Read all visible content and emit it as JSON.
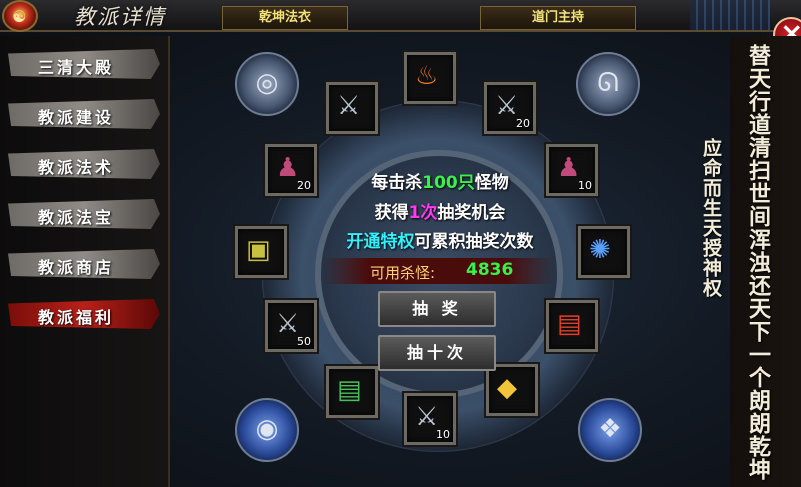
{
  "header": {
    "title": "教派详情",
    "tabs": [
      {
        "label": "乾坤法衣"
      },
      {
        "label": "道门主持"
      }
    ],
    "close_icon": "close-icon"
  },
  "sidebar": {
    "items": [
      {
        "label": "三清大殿",
        "active": false
      },
      {
        "label": "教派建设",
        "active": false
      },
      {
        "label": "教派法术",
        "active": false
      },
      {
        "label": "教派法宝",
        "active": false
      },
      {
        "label": "教派商店",
        "active": false
      },
      {
        "label": "教派福利",
        "active": true
      }
    ]
  },
  "lottery": {
    "line1_a": "每击杀",
    "line1_b": "100只",
    "line1_c": "怪物",
    "line2_a": "获得",
    "line2_b": "1次",
    "line2_c": "抽奖机会",
    "line3_a": "开通特权",
    "line3_b": "可累积抽奖次数",
    "kills_label": "可用杀怪:",
    "kills_value": "4836",
    "draw_once": "抽 奖",
    "draw_ten": "抽十次"
  },
  "prizes": [
    {
      "icon": "fire-scroll-icon",
      "count": ""
    },
    {
      "icon": "dagger-icon",
      "count": "20"
    },
    {
      "icon": "gourd-icon",
      "count": "10"
    },
    {
      "icon": "blue-orb-icon",
      "count": ""
    },
    {
      "icon": "red-book-icon",
      "count": ""
    },
    {
      "icon": "gold-ingot-icon",
      "count": ""
    },
    {
      "icon": "dagger-icon",
      "count": "10"
    },
    {
      "icon": "green-book-icon",
      "count": ""
    },
    {
      "icon": "dagger-icon",
      "count": "50"
    },
    {
      "icon": "jade-box-icon",
      "count": ""
    },
    {
      "icon": "gourd-icon",
      "count": "20"
    },
    {
      "icon": "dagger-icon",
      "count": ""
    }
  ],
  "right_text": {
    "main": "替天行道清扫世间浑浊还天下一个朗朗乾坤",
    "sub": "应命而生天授神权"
  }
}
